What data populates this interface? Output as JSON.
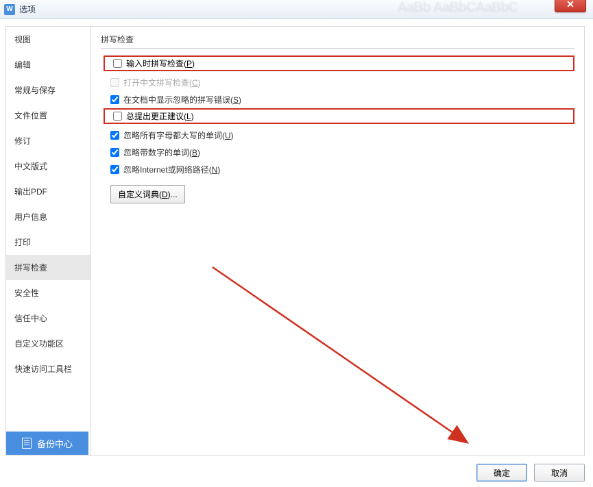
{
  "window": {
    "title": "选项",
    "bg_text": "AaBb AaBbCAaBbC"
  },
  "sidebar": {
    "items": [
      {
        "label": "视图"
      },
      {
        "label": "编辑"
      },
      {
        "label": "常规与保存"
      },
      {
        "label": "文件位置"
      },
      {
        "label": "修订"
      },
      {
        "label": "中文版式"
      },
      {
        "label": "输出PDF"
      },
      {
        "label": "用户信息"
      },
      {
        "label": "打印"
      },
      {
        "label": "拼写检查"
      },
      {
        "label": "安全性"
      },
      {
        "label": "信任中心"
      },
      {
        "label": "自定义功能区"
      },
      {
        "label": "快速访问工具栏"
      }
    ],
    "selected_index": 9
  },
  "content": {
    "group_title": "拼写检查",
    "options": [
      {
        "label": "输入时拼写检查(",
        "key": "P",
        "suffix": ")",
        "checked": false,
        "highlight": true,
        "disabled": false
      },
      {
        "label": "打开中文拼写检查(",
        "key": "C",
        "suffix": ")",
        "checked": false,
        "highlight": false,
        "disabled": true
      },
      {
        "label": "在文档中显示忽略的拼写错误(",
        "key": "S",
        "suffix": ")",
        "checked": true,
        "highlight": false,
        "disabled": false
      },
      {
        "label": "总提出更正建议(",
        "key": "L",
        "suffix": ")",
        "checked": false,
        "highlight": true,
        "disabled": false
      },
      {
        "label": "忽略所有字母都大写的单词(",
        "key": "U",
        "suffix": ")",
        "checked": true,
        "highlight": false,
        "disabled": false
      },
      {
        "label": "忽略带数字的单词(",
        "key": "B",
        "suffix": ")",
        "checked": true,
        "highlight": false,
        "disabled": false
      },
      {
        "label": "忽略Internet或网络路径(",
        "key": "N",
        "suffix": ")",
        "checked": true,
        "highlight": false,
        "disabled": false
      }
    ],
    "custom_dict_label": "自定义词典(",
    "custom_dict_key": "D",
    "custom_dict_suffix": ")..."
  },
  "backup": {
    "label": "备份中心"
  },
  "footer": {
    "ok": "确定",
    "cancel": "取消"
  }
}
